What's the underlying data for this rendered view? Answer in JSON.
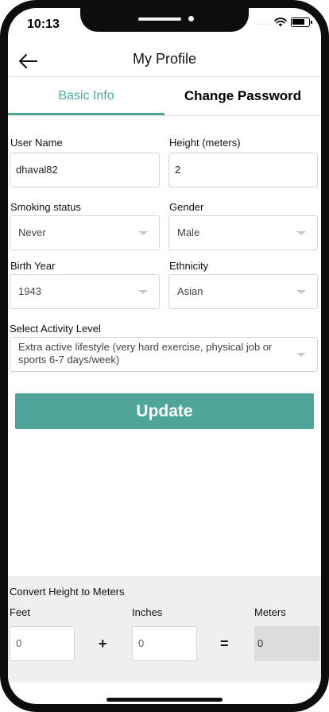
{
  "status_bar": {
    "time": "10:13",
    "signal": "....."
  },
  "header": {
    "title": "My Profile",
    "back_icon": "arrow-left-icon"
  },
  "tabs": [
    {
      "label": "Basic Info",
      "active": true
    },
    {
      "label": "Change Password",
      "active": false
    }
  ],
  "form": {
    "user_name": {
      "label": "User Name",
      "value": "dhaval82"
    },
    "height": {
      "label": "Height (meters)",
      "value": "2"
    },
    "smoking": {
      "label": "Smoking status",
      "value": "Never"
    },
    "gender": {
      "label": "Gender",
      "value": "Male"
    },
    "birth_year": {
      "label": "Birth Year",
      "value": "1943"
    },
    "ethnicity": {
      "label": "Ethnicity",
      "value": "Asian"
    },
    "activity": {
      "label": "Select Activity Level",
      "value": "Extra active lifestyle (very hard exercise, physical job or sports 6-7 days/week)"
    },
    "update_label": "Update"
  },
  "converter": {
    "title": "Convert Height to Meters",
    "feet_label": "Feet",
    "inches_label": "Inches",
    "meters_label": "Meters",
    "feet_value": "0",
    "inches_value": "0",
    "meters_value": "0",
    "plus": "+",
    "equals": "="
  },
  "colors": {
    "accent": "#4fa59a",
    "panel": "#efefef"
  }
}
